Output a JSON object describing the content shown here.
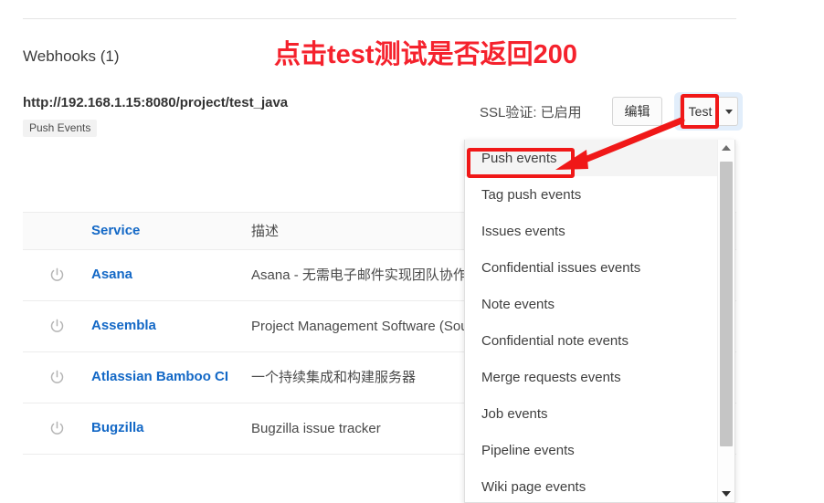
{
  "annotation": {
    "text": "点击test测试是否返回200",
    "color": "#f5222d",
    "arrow_name": "red-arrow-to-push-events"
  },
  "webhooks": {
    "heading": "Webhooks (1)",
    "hook": {
      "url": "http://192.168.1.15:8080/project/test_java",
      "badge": "Push Events",
      "ssl_label": "SSL验证: 已启用",
      "edit_button": "编辑",
      "test_button": "Test",
      "caret_icon": "chevron-down-icon"
    }
  },
  "dropdown": {
    "items": [
      {
        "label": "Push events",
        "active": true
      },
      {
        "label": "Tag push events",
        "active": false
      },
      {
        "label": "Issues events",
        "active": false
      },
      {
        "label": "Confidential issues events",
        "active": false
      },
      {
        "label": "Note events",
        "active": false
      },
      {
        "label": "Confidential note events",
        "active": false
      },
      {
        "label": "Merge requests events",
        "active": false
      },
      {
        "label": "Job events",
        "active": false
      },
      {
        "label": "Pipeline events",
        "active": false
      },
      {
        "label": "Wiki page events",
        "active": false
      }
    ],
    "scrollbar": {
      "up_icon": "scroll-up-arrow-icon",
      "down_icon": "scroll-down-arrow-icon"
    }
  },
  "services_table": {
    "columns": [
      "",
      "Service",
      "描述"
    ],
    "rows": [
      {
        "toggle_icon": "power-icon",
        "service": "Asana",
        "description": "Asana - 无需电子邮件实现团队协作"
      },
      {
        "toggle_icon": "power-icon",
        "service": "Assembla",
        "description": "Project Management Software (Source Commits Endpoint)"
      },
      {
        "toggle_icon": "power-icon",
        "service": "Atlassian Bamboo CI",
        "description": "一个持续集成和构建服务器"
      },
      {
        "toggle_icon": "power-icon",
        "service": "Bugzilla",
        "description": "Bugzilla issue tracker"
      }
    ]
  }
}
